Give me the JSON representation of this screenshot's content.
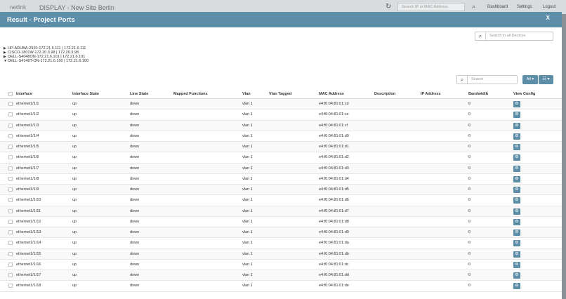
{
  "background": {
    "brand": "netlink",
    "app_title": "DISPLAY - New Site Berlin",
    "refresh_icon": "refresh-icon",
    "search_placeholder": "Search IP or MAC Address",
    "nav": [
      "Dashboard",
      "Settings",
      "Logout"
    ]
  },
  "modal": {
    "title": "Result - Project Ports",
    "close": "X",
    "device_search_placeholder": "Search in all Devices",
    "devices": [
      {
        "expanded": false,
        "label": "HP-ARUBA-2920-172.21.6.111 | 172.21.6.111"
      },
      {
        "expanded": false,
        "label": "CISCO-1801W-172.20.3.98 | 172.20.3.98"
      },
      {
        "expanded": false,
        "label": "DELL-S4048ON-172.21.6.101 | 172.21.6.101"
      },
      {
        "expanded": true,
        "label": "DELL-S4148T-ON-172.21.6.100 | 172.21.6.100"
      }
    ],
    "table_search_placeholder": "Search",
    "all_button": "All ▾",
    "columns_button": "☷ ▾"
  },
  "table": {
    "columns": [
      "Interface",
      "Interface State",
      "Line State",
      "Mapped Functions",
      "Vlan",
      "Vlan Tagged",
      "MAC Address",
      "Description",
      "IP Address",
      "Bandwidth",
      "View Config"
    ],
    "rows": [
      {
        "interface": "ethernet1/1/1",
        "if_state": "up",
        "line_state": "down",
        "mapped": "",
        "vlan": "vlan 1",
        "vlan_tagged": "",
        "mac": "e4:f0:04:81:01:cd",
        "desc": "",
        "ip": "",
        "bw": "0"
      },
      {
        "interface": "ethernet1/1/2",
        "if_state": "up",
        "line_state": "down",
        "mapped": "",
        "vlan": "vlan 1",
        "vlan_tagged": "",
        "mac": "e4:f0:04:81:01:ce",
        "desc": "",
        "ip": "",
        "bw": "0"
      },
      {
        "interface": "ethernet1/1/3",
        "if_state": "up",
        "line_state": "down",
        "mapped": "",
        "vlan": "vlan 1",
        "vlan_tagged": "",
        "mac": "e4:f0:04:81:01:cf",
        "desc": "",
        "ip": "",
        "bw": "0"
      },
      {
        "interface": "ethernet1/1/4",
        "if_state": "up",
        "line_state": "down",
        "mapped": "",
        "vlan": "vlan 1",
        "vlan_tagged": "",
        "mac": "e4:f0:04:81:01:d0",
        "desc": "",
        "ip": "",
        "bw": "0"
      },
      {
        "interface": "ethernet1/1/5",
        "if_state": "up",
        "line_state": "down",
        "mapped": "",
        "vlan": "vlan 1",
        "vlan_tagged": "",
        "mac": "e4:f0:04:81:01:d1",
        "desc": "",
        "ip": "",
        "bw": "0"
      },
      {
        "interface": "ethernet1/1/6",
        "if_state": "up",
        "line_state": "down",
        "mapped": "",
        "vlan": "vlan 1",
        "vlan_tagged": "",
        "mac": "e4:f0:04:81:01:d2",
        "desc": "",
        "ip": "",
        "bw": "0"
      },
      {
        "interface": "ethernet1/1/7",
        "if_state": "up",
        "line_state": "down",
        "mapped": "",
        "vlan": "vlan 1",
        "vlan_tagged": "",
        "mac": "e4:f0:04:81:01:d3",
        "desc": "",
        "ip": "",
        "bw": "0"
      },
      {
        "interface": "ethernet1/1/8",
        "if_state": "up",
        "line_state": "down",
        "mapped": "",
        "vlan": "vlan 1",
        "vlan_tagged": "",
        "mac": "e4:f0:04:81:01:d4",
        "desc": "",
        "ip": "",
        "bw": "0"
      },
      {
        "interface": "ethernet1/1/9",
        "if_state": "up",
        "line_state": "down",
        "mapped": "",
        "vlan": "vlan 1",
        "vlan_tagged": "",
        "mac": "e4:f0:04:81:01:d5",
        "desc": "",
        "ip": "",
        "bw": "0"
      },
      {
        "interface": "ethernet1/1/10",
        "if_state": "up",
        "line_state": "down",
        "mapped": "",
        "vlan": "vlan 1",
        "vlan_tagged": "",
        "mac": "e4:f0:04:81:01:d6",
        "desc": "",
        "ip": "",
        "bw": "0"
      },
      {
        "interface": "ethernet1/1/11",
        "if_state": "up",
        "line_state": "down",
        "mapped": "",
        "vlan": "vlan 1",
        "vlan_tagged": "",
        "mac": "e4:f0:04:81:01:d7",
        "desc": "",
        "ip": "",
        "bw": "0"
      },
      {
        "interface": "ethernet1/1/12",
        "if_state": "up",
        "line_state": "down",
        "mapped": "",
        "vlan": "vlan 1",
        "vlan_tagged": "",
        "mac": "e4:f0:04:81:01:d8",
        "desc": "",
        "ip": "",
        "bw": "0"
      },
      {
        "interface": "ethernet1/1/13",
        "if_state": "up",
        "line_state": "down",
        "mapped": "",
        "vlan": "vlan 1",
        "vlan_tagged": "",
        "mac": "e4:f0:04:81:01:d9",
        "desc": "",
        "ip": "",
        "bw": "0"
      },
      {
        "interface": "ethernet1/1/14",
        "if_state": "up",
        "line_state": "down",
        "mapped": "",
        "vlan": "vlan 1",
        "vlan_tagged": "",
        "mac": "e4:f0:04:81:01:da",
        "desc": "",
        "ip": "",
        "bw": "0"
      },
      {
        "interface": "ethernet1/1/15",
        "if_state": "up",
        "line_state": "down",
        "mapped": "",
        "vlan": "vlan 1",
        "vlan_tagged": "",
        "mac": "e4:f0:04:81:01:db",
        "desc": "",
        "ip": "",
        "bw": "0"
      },
      {
        "interface": "ethernet1/1/16",
        "if_state": "up",
        "line_state": "down",
        "mapped": "",
        "vlan": "vlan 1",
        "vlan_tagged": "",
        "mac": "e4:f0:04:81:01:dc",
        "desc": "",
        "ip": "",
        "bw": "0"
      },
      {
        "interface": "ethernet1/1/17",
        "if_state": "up",
        "line_state": "down",
        "mapped": "",
        "vlan": "vlan 1",
        "vlan_tagged": "",
        "mac": "e4:f0:04:81:01:dd",
        "desc": "",
        "ip": "",
        "bw": "0"
      },
      {
        "interface": "ethernet1/1/18",
        "if_state": "up",
        "line_state": "down",
        "mapped": "",
        "vlan": "vlan 1",
        "vlan_tagged": "",
        "mac": "e4:f0:04:81:01:de",
        "desc": "",
        "ip": "",
        "bw": "0"
      }
    ],
    "config_icon": "gear-icon"
  },
  "colors": {
    "accent": "#5d8ea8",
    "overlay": "#8a9197"
  }
}
